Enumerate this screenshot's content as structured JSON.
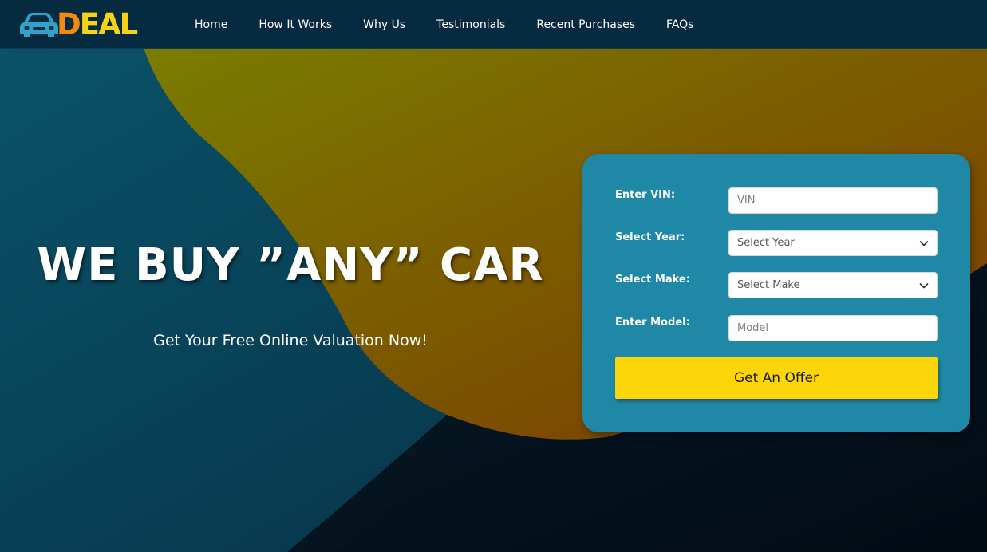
{
  "brand": {
    "logo_text_first": "D",
    "logo_text_rest": "EAL",
    "colors": {
      "orange": "#f28a12",
      "yellow": "#f5d31a",
      "car": "#2fa3c9"
    }
  },
  "nav": {
    "items": [
      {
        "label": "Home"
      },
      {
        "label": "How It Works"
      },
      {
        "label": "Why Us"
      },
      {
        "label": "Testimonials"
      },
      {
        "label": "Recent Purchases"
      },
      {
        "label": "FAQs"
      }
    ]
  },
  "hero": {
    "title": "WE BUY ”ANY” CAR",
    "subtitle": "Get Your Free Online Valuation Now!"
  },
  "form": {
    "vin": {
      "label": "Enter VIN:",
      "placeholder": "VIN",
      "value": ""
    },
    "year": {
      "label": "Select Year:",
      "selected": "Select Year"
    },
    "make": {
      "label": "Select Make:",
      "selected": "Select Make"
    },
    "model": {
      "label": "Enter Model:",
      "placeholder": "Model",
      "value": ""
    },
    "submit_label": "Get An Offer",
    "colors": {
      "card": "#1f88a6",
      "button": "#fdd50b"
    }
  },
  "icons": {
    "logo": "car-icon",
    "dropdown": "chevron-down-icon"
  }
}
